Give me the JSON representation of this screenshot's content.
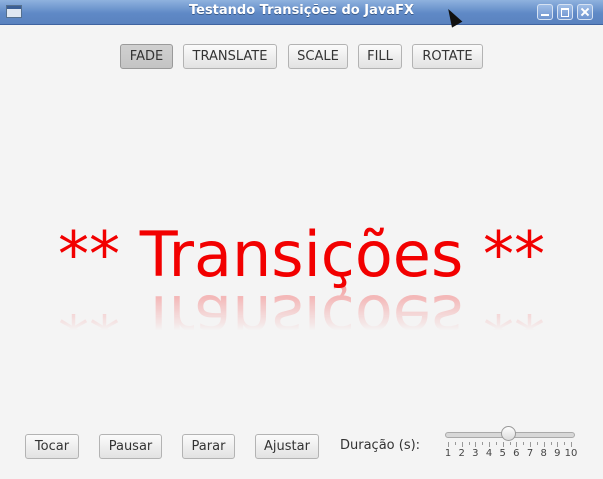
{
  "window": {
    "title": "Testando Transições do JavaFX"
  },
  "top_buttons": [
    "FADE",
    "TRANSLATE",
    "SCALE",
    "FILL",
    "ROTATE"
  ],
  "selected_top_button": "FADE",
  "display_text": "** Transições **",
  "bottom_buttons": {
    "play": "Tocar",
    "pause": "Pausar",
    "stop": "Parar",
    "adjust": "Ajustar"
  },
  "duration": {
    "label": "Duração (s):",
    "min": 1,
    "max": 10,
    "value": 5,
    "tick_labels": [
      "1",
      "2",
      "3",
      "4",
      "5",
      "6",
      "7",
      "8",
      "9",
      "10"
    ]
  },
  "colors": {
    "text_red": "#f20000",
    "titlebar": "#6b90cc"
  }
}
